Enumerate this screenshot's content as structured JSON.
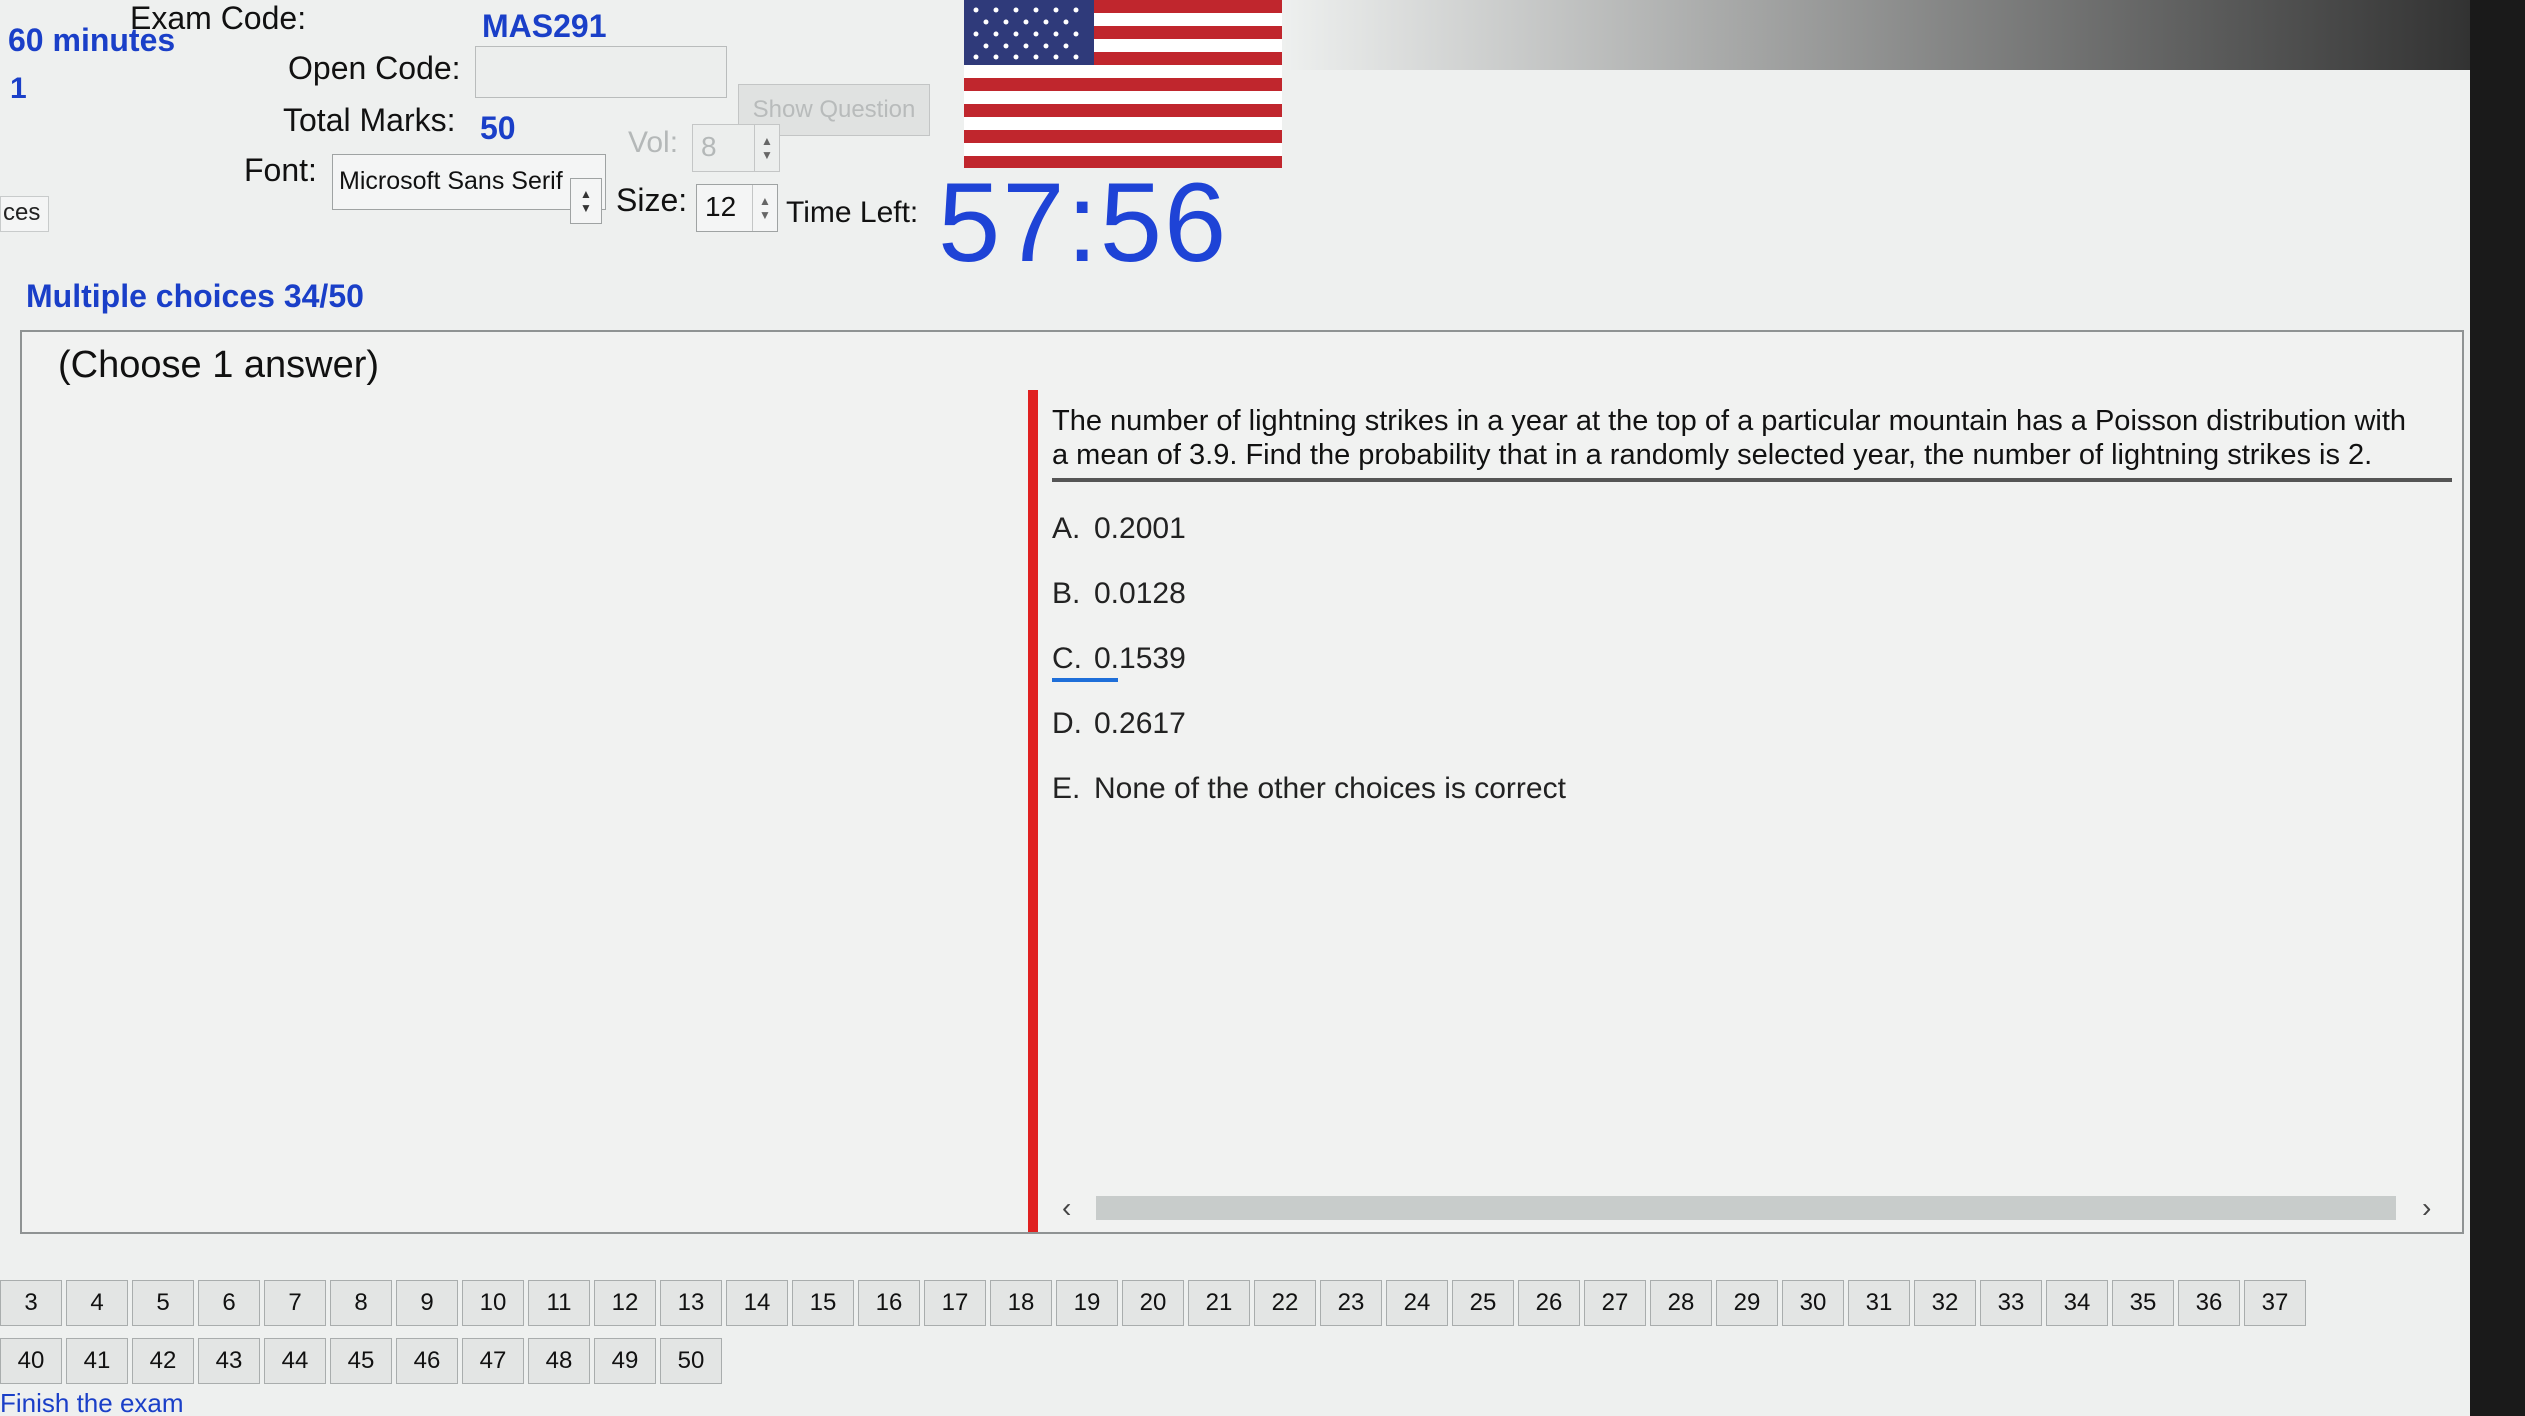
{
  "header": {
    "exam_code_label": "Exam Code:",
    "exam_code_value": "MAS291",
    "duration": "60 minutes",
    "student_no": "1",
    "open_code_label": "Open Code:",
    "open_code_value": "",
    "show_question_label": "Show Question",
    "total_marks_label": "Total Marks:",
    "total_marks_value": "50",
    "vol_label": "Vol:",
    "vol_value": "8",
    "font_label": "Font:",
    "font_value": "Microsoft Sans Serif",
    "size_label": "Size:",
    "size_value": "12",
    "time_left_label": "Time Left:",
    "time_left_value": "57:56",
    "side_tab_label": "ces"
  },
  "section": {
    "title": "Multiple choices 34/50",
    "choose_hint": "(Choose 1 answer)"
  },
  "question": {
    "text": "The number of lightning strikes in a year at the top of a particular mountain has a Poisson distribution with a mean of  3.9. Find the probability that in a randomly selected year, the number of lightning strikes is  2.",
    "answers": [
      {
        "letter": "A.",
        "text": "0.2001",
        "selected": false
      },
      {
        "letter": "B.",
        "text": "0.0128",
        "selected": false
      },
      {
        "letter": "C.",
        "text": "0.1539",
        "selected": true
      },
      {
        "letter": "D.",
        "text": "0.2617",
        "selected": false
      },
      {
        "letter": "E.",
        "text": "None of the other choices is correct",
        "selected": false
      }
    ]
  },
  "navigation": {
    "row1": [
      "3",
      "4",
      "5",
      "6",
      "7",
      "8",
      "9",
      "10",
      "11",
      "12",
      "13",
      "14",
      "15",
      "16",
      "17",
      "18",
      "19",
      "20",
      "21",
      "22",
      "23",
      "24",
      "25",
      "26",
      "27",
      "28",
      "29",
      "30",
      "31",
      "32",
      "33",
      "34",
      "35",
      "36",
      "37"
    ],
    "row2": [
      "40",
      "41",
      "42",
      "43",
      "44",
      "45",
      "46",
      "47",
      "48",
      "49",
      "50"
    ],
    "finish_label": "Finish the exam"
  },
  "colors": {
    "accent_blue": "#1a3fc8",
    "timer_blue": "#1e43d6",
    "divider_red": "#e02020"
  }
}
